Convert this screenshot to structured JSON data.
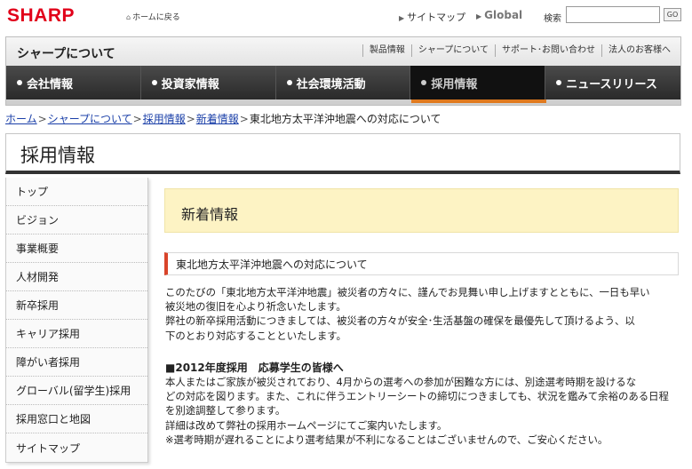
{
  "header": {
    "logo": "SHARP",
    "home_link": "ホームに戻る",
    "sitemap": "サイトマップ",
    "global": "Global",
    "search_label": "検索",
    "search_value": "",
    "go_label": "GO"
  },
  "about": {
    "title": "シャープについて",
    "links": [
      "製品情報",
      "シャープについて",
      "サポート･お問い合わせ",
      "法人のお客様へ"
    ]
  },
  "nav": {
    "tabs": [
      "会社情報",
      "投資家情報",
      "社会環境活動",
      "採用情報",
      "ニュースリリース"
    ],
    "active_index": 3
  },
  "breadcrumb": {
    "items": [
      "ホーム",
      "シャープについて",
      "採用情報",
      "新着情報"
    ],
    "current": "東北地方太平洋沖地震への対応について"
  },
  "page_title": "採用情報",
  "sidebar": {
    "items": [
      "トップ",
      "ビジョン",
      "事業概要",
      "人材開発",
      "新卒採用",
      "キャリア採用",
      "障がい者採用",
      "グローバル(留学生)採用",
      "採用窓口と地図",
      "サイトマップ"
    ]
  },
  "content": {
    "banner_title": "新着情報",
    "section_title": "東北地方太平洋沖地震への対応について",
    "para1": [
      "このたびの「東北地方太平洋沖地震」被災者の方々に、謹んでお見舞い申し上げますとともに、一日も早い",
      "被災地の復旧を心より祈念いたします。",
      "弊社の新卒採用活動につきましては、被災者の方々が安全･生活基盤の確保を最優先して頂けるよう、以",
      "下のとおり対応することといたします。"
    ],
    "subhead": "■2012年度採用　応募学生の皆様へ",
    "para2": [
      "本人またはご家族が被災されており、4月からの選考への参加が困難な方には、別途選考時期を設けるな",
      "どの対応を図ります。また、これに伴うエントリーシートの締切につきましても、状況を鑑みて余裕のある日程",
      "を別途調整して参ります。",
      "詳細は改めて弊社の採用ホームページにてご案内いたします。",
      "※選考時期が遅れることにより選考結果が不利になることはございませんので、ご安心ください。"
    ]
  },
  "colors": {
    "brand_red": "#e1001a",
    "active_underline": "#e07a1f",
    "banner_bg": "#fdf3c4",
    "section_accent": "#d9442a",
    "link_blue": "#1a3fa8"
  }
}
